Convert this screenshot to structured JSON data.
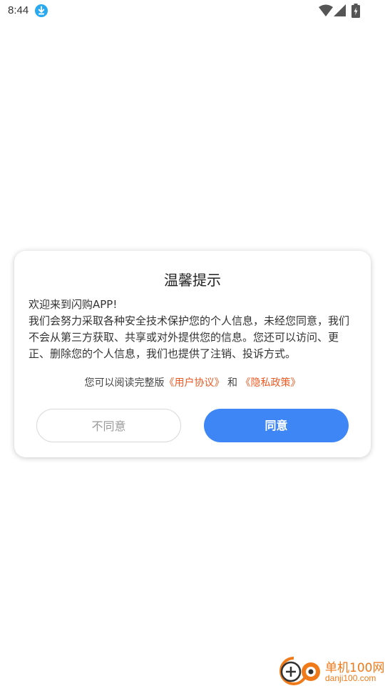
{
  "status_bar": {
    "time": "8:44",
    "icons": [
      "download-notification-icon",
      "wifi-icon",
      "cell-signal-icon",
      "battery-charging-icon"
    ]
  },
  "dialog": {
    "title": "温馨提示",
    "body_lines": [
      "欢迎来到闪购APP!",
      "我们会努力采取各种安全技术保护您的个人信息，未经您同意，我们不会从第三方获取、共享或对外提供您的信息。您还可以访问、更正、删除您的个人信息，我们也提供了注销、投诉方式。"
    ],
    "links_prefix": "您可以阅读完整版",
    "user_agreement_link": "《用户协议》",
    "links_conjunction": "和",
    "privacy_policy_link": "《隐私政策》",
    "disagree_label": "不同意",
    "agree_label": "同意"
  },
  "watermark": {
    "name": "单机100网",
    "url": "danji100.com"
  },
  "colors": {
    "accent_blue": "#3e86f6",
    "link_orange": "#f05a24",
    "watermark_orange": "#f07a1a",
    "download_icon_blue": "#29a9f0"
  }
}
